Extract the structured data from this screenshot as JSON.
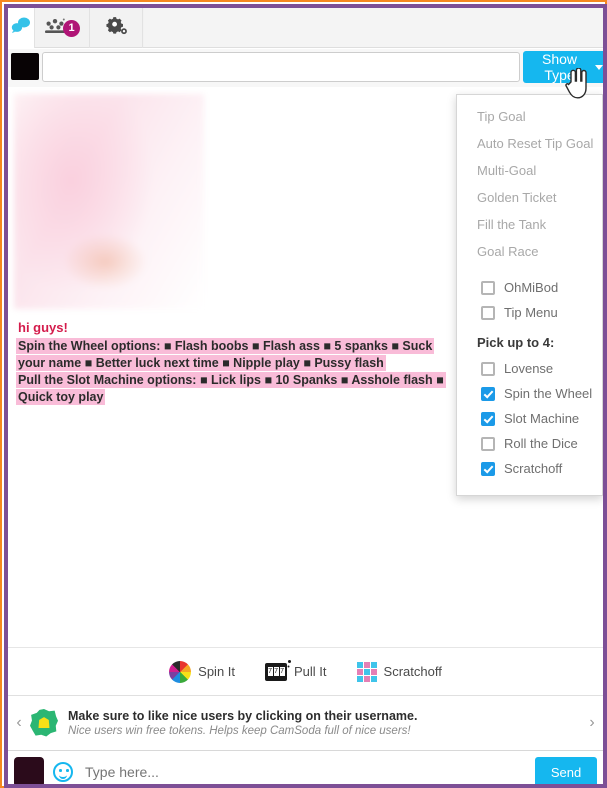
{
  "window": {
    "outer_border_color": "#f5881f",
    "inner_border_color": "#7d4f96"
  },
  "tabs": [
    {
      "name": "chat-tab",
      "icon": "chat-bubble-icon",
      "active": true,
      "badge": ""
    },
    {
      "name": "users-tab",
      "icon": "users-group-icon",
      "active": false,
      "badge": "1"
    },
    {
      "name": "settings-tab",
      "icon": "gear-icon",
      "active": false,
      "badge": ""
    }
  ],
  "toolbar": {
    "topic_value": "",
    "topic_placeholder": "",
    "show_type_label": "Show Type",
    "accent_color": "#15b7ef"
  },
  "dropdown": {
    "links": [
      "Tip Goal",
      "Auto Reset Tip Goal",
      "Multi-Goal",
      "Golden Ticket",
      "Fill the Tank",
      "Goal Race"
    ],
    "toggles": [
      {
        "label": "OhMiBod",
        "checked": false
      },
      {
        "label": "Tip Menu",
        "checked": false
      }
    ],
    "pick_header": "Pick up to 4:",
    "games": [
      {
        "label": "Lovense",
        "checked": false
      },
      {
        "label": "Spin the Wheel",
        "checked": true
      },
      {
        "label": "Slot Machine",
        "checked": true
      },
      {
        "label": "Roll the Dice",
        "checked": false
      },
      {
        "label": "Scratchoff",
        "checked": true
      }
    ]
  },
  "chat": {
    "greeting": "hi guys!",
    "wheel_line": "Spin the Wheel options:   ■ Flash boobs   ■ Flash ass   ■ 5 spanks   ■ Suck your name   ■ Better luck next time   ■ Nipple play   ■ Pussy flash",
    "slot_line": "Pull the Slot Machine options:   ■ Lick lips   ■ 10 Spanks   ■ Asshole flash   ■ Quick toy play",
    "highlight_color": "#f9bcd8",
    "greeting_color": "#d41c4c"
  },
  "games_bar": [
    {
      "label": "Spin It",
      "icon": "wheel-icon"
    },
    {
      "label": "Pull It",
      "icon": "slot-machine-icon"
    },
    {
      "label": "Scratchoff",
      "icon": "scratchoff-grid-icon"
    }
  ],
  "notice": {
    "prev_arrow": "‹",
    "next_arrow": "›",
    "icon": "trophy-badge-icon",
    "title": "Make sure to like nice users by clicking on their username.",
    "subtitle": "Nice users win free tokens. Helps keep CamSoda full of nice users!"
  },
  "composer": {
    "placeholder": "Type here...",
    "value": "",
    "send_label": "Send",
    "emoji_icon": "smiley-icon"
  }
}
